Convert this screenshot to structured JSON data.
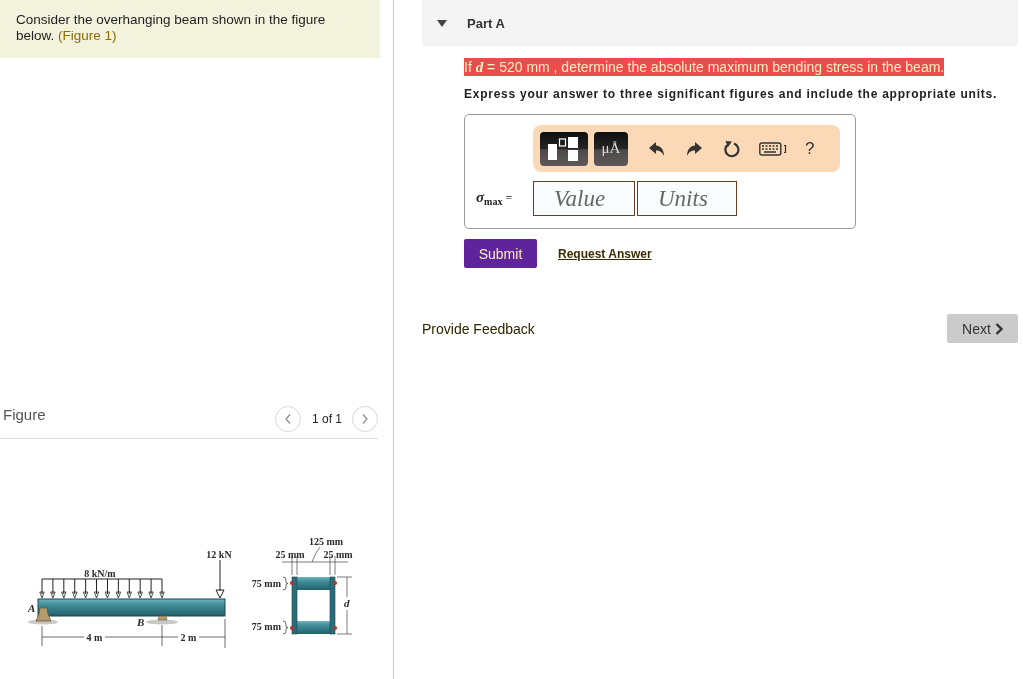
{
  "problem": {
    "text": "Consider the overhanging beam shown in the figure below.",
    "link": "(Figure 1)"
  },
  "figure": {
    "title": "Figure",
    "pager": "1 of 1",
    "diagram": {
      "load": "8 kN/m",
      "point_load": "12 kN",
      "support_a": "A",
      "support_b": "B",
      "span": "4 m",
      "overhang": "2 m",
      "section": {
        "inner_width": "125 mm",
        "web_left": "25 mm",
        "web_right": "25 mm",
        "flange_top": "75 mm",
        "flange_bottom": "75 mm",
        "depth": "d"
      }
    }
  },
  "part": {
    "title": "Part A",
    "expanded": true,
    "question": {
      "text": "If *d* = 520 mm , determine the absolute maximum bending stress in the beam.",
      "highlighted": true
    },
    "instruction": "Express your answer to three significant figures and include the appropriate units.",
    "toolbar": [
      {
        "kind": "templates"
      },
      {
        "kind": "units",
        "label": "μÅ"
      },
      {
        "kind": "undo"
      },
      {
        "kind": "redo"
      },
      {
        "kind": "reset"
      },
      {
        "kind": "keyboard"
      },
      {
        "kind": "help",
        "label": "?"
      }
    ],
    "answer": {
      "label": "*σ*$_{max}$ =",
      "fields": [
        {
          "kind": "value",
          "placeholder": "Value"
        },
        {
          "kind": "units",
          "placeholder": "Units"
        }
      ]
    },
    "submit": "Submit",
    "request": "Request Answer"
  },
  "footer": {
    "feedback": "Provide Feedback",
    "next": "Next"
  }
}
